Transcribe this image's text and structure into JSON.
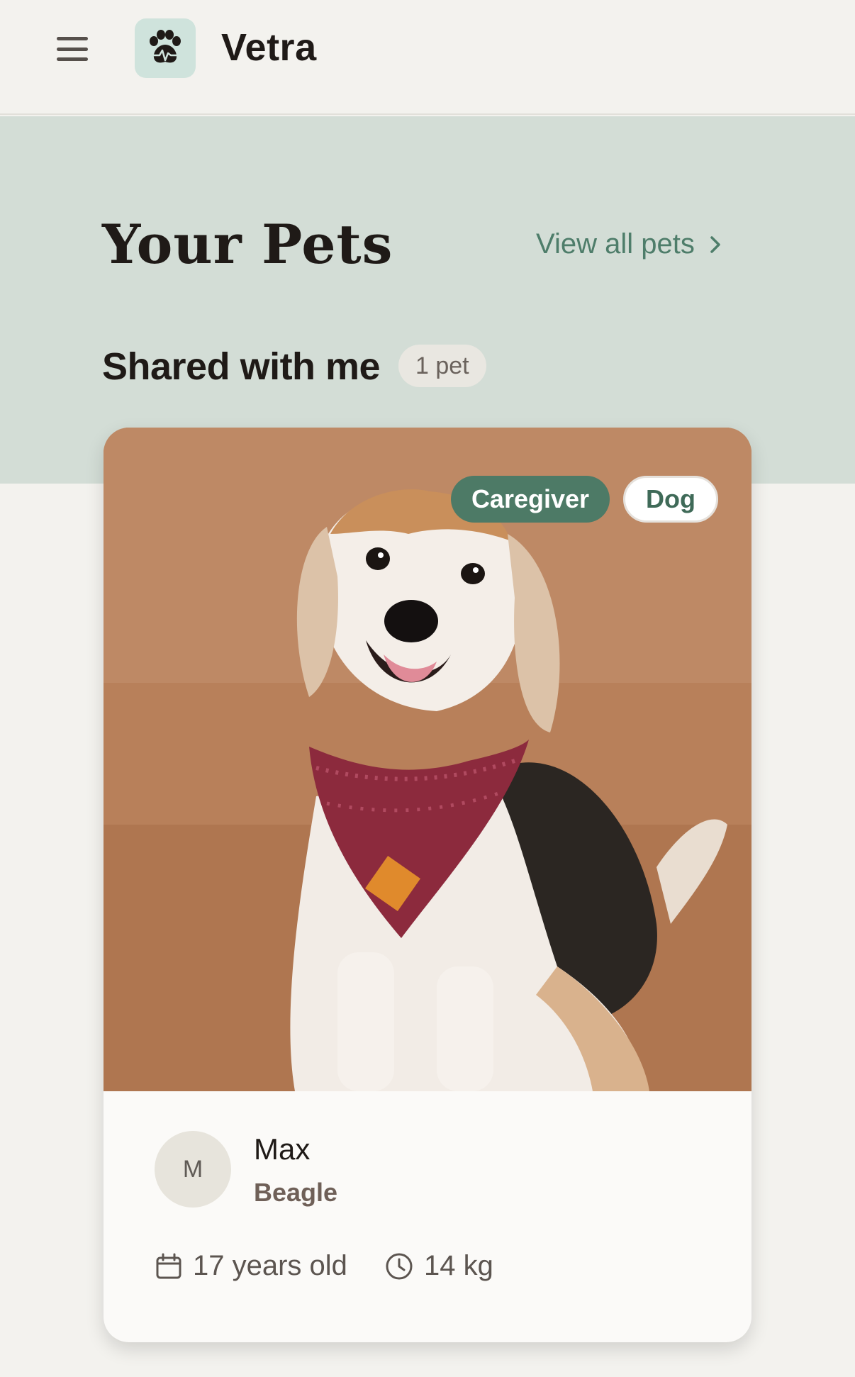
{
  "header": {
    "app_title": "Vetra",
    "logo_icon": "paw-heartbeat-icon",
    "menu_icon": "hamburger-menu-icon"
  },
  "page": {
    "title": "Your Pets",
    "view_all_label": "View all pets",
    "view_all_icon": "chevron-right-icon"
  },
  "section": {
    "title": "Shared with me",
    "count_label": "1 pet"
  },
  "pets": [
    {
      "role_badge": "Caregiver",
      "species_badge": "Dog",
      "avatar_initial": "M",
      "name": "Max",
      "breed": "Beagle",
      "age": "17 years old",
      "age_icon": "calendar-icon",
      "weight": "14 kg",
      "weight_icon": "clock-icon"
    }
  ],
  "colors": {
    "accent": "#4d7a66",
    "hero_bg": "#d3ddd6",
    "page_bg": "#f3f2ee"
  }
}
